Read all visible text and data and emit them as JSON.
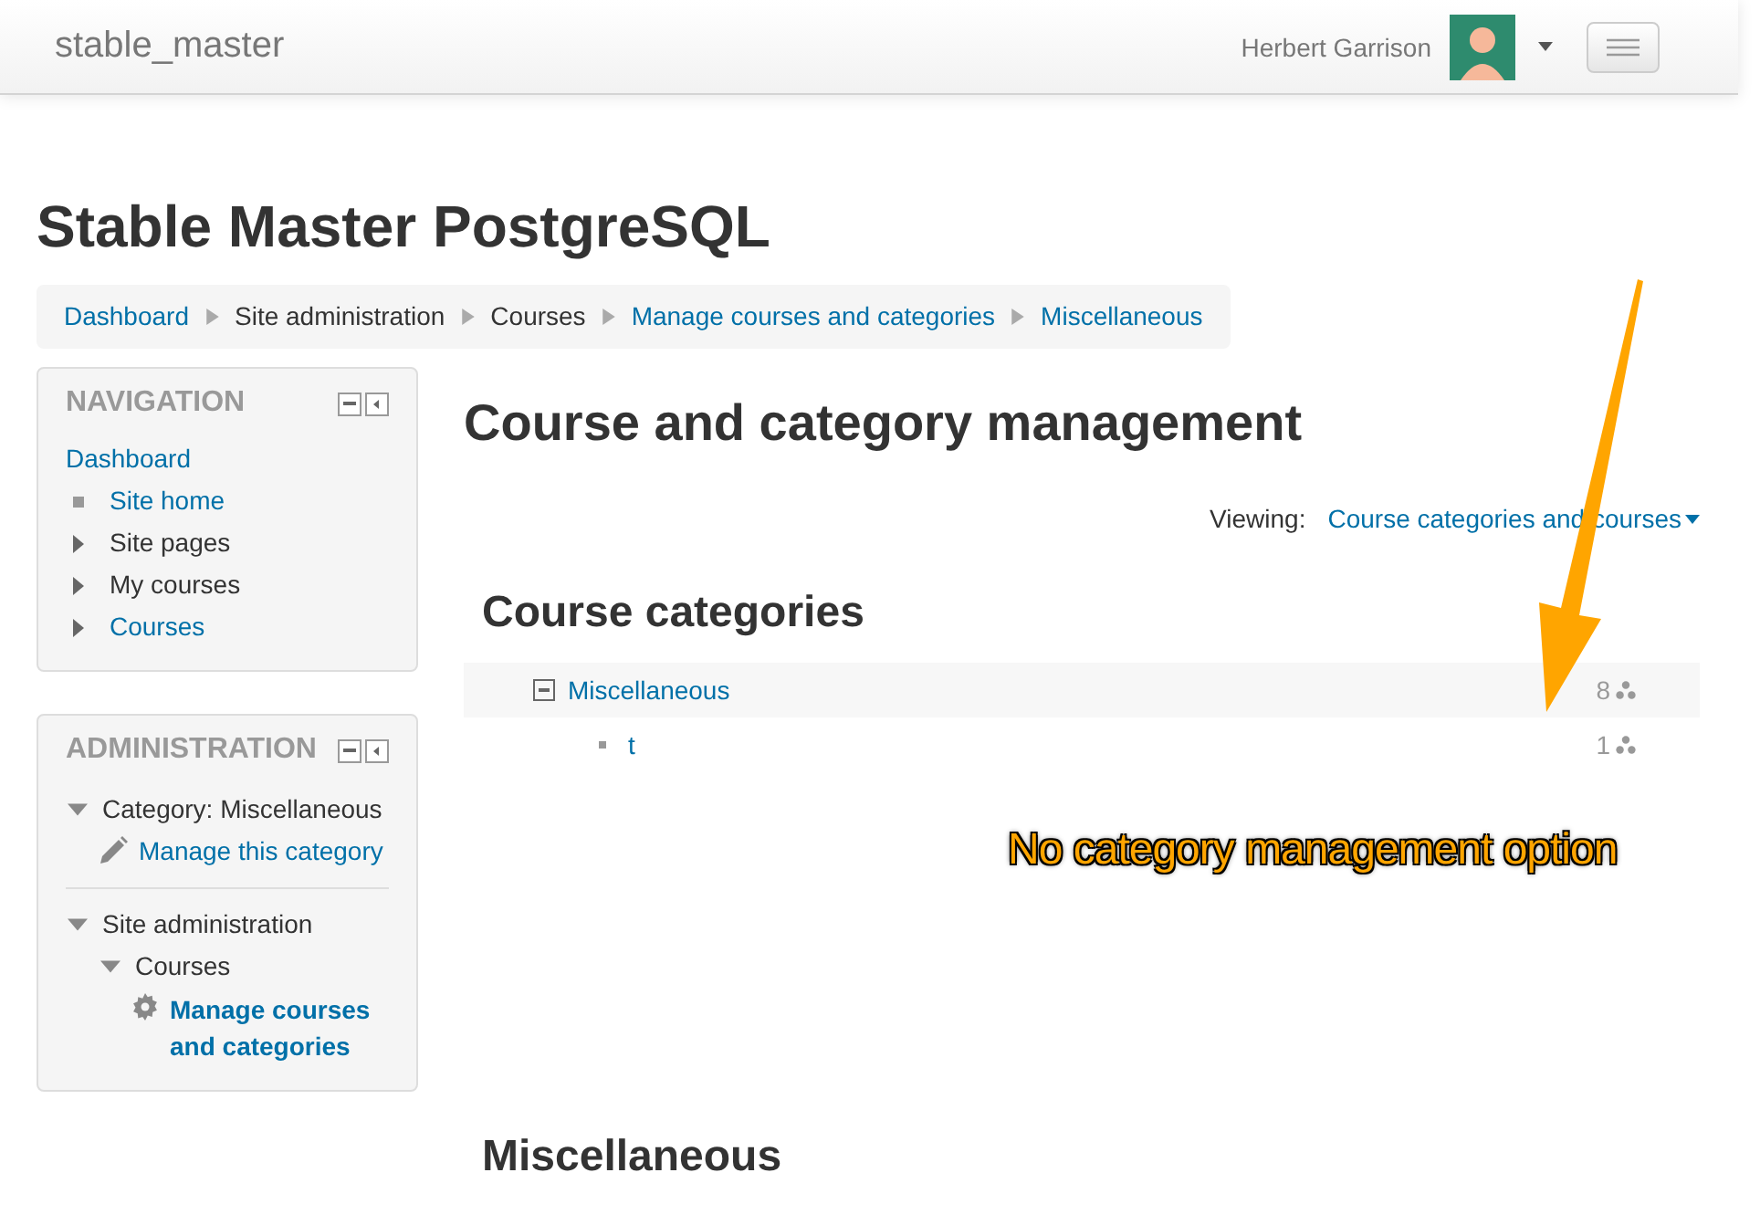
{
  "navbar": {
    "brand": "stable_master",
    "user_name": "Herbert Garrison"
  },
  "page_title": "Stable Master PostgreSQL",
  "breadcrumb": [
    {
      "label": "Dashboard",
      "link": true
    },
    {
      "label": "Site administration",
      "link": false
    },
    {
      "label": "Courses",
      "link": false
    },
    {
      "label": "Manage courses and categories",
      "link": true
    },
    {
      "label": "Miscellaneous",
      "link": true
    }
  ],
  "navigation_block": {
    "title": "NAVIGATION",
    "top_link": "Dashboard",
    "items": [
      {
        "label": "Site home",
        "kind": "bullet",
        "link": true
      },
      {
        "label": "Site pages",
        "kind": "collapsed",
        "link": false
      },
      {
        "label": "My courses",
        "kind": "collapsed",
        "link": false
      },
      {
        "label": "Courses",
        "kind": "collapsed",
        "link": true
      }
    ]
  },
  "administration_block": {
    "title": "ADMINISTRATION",
    "sections": [
      {
        "label": "Category: Miscellaneous",
        "expanded": true,
        "children": [
          {
            "label": "Manage this category",
            "kind": "edit",
            "current": false
          }
        ]
      },
      {
        "label": "Site administration",
        "expanded": true,
        "children": [
          {
            "label": "Courses",
            "kind": "branch",
            "expanded": true,
            "children": [
              {
                "label": "Manage courses and categories",
                "kind": "settings",
                "current": true
              }
            ]
          }
        ]
      }
    ]
  },
  "main": {
    "heading": "Course and category management",
    "viewing_label": "Viewing:",
    "viewing_value": "Course categories and courses",
    "categories_heading": "Course categories",
    "categories": [
      {
        "name": "Miscellaneous",
        "count": "8",
        "expanded": true,
        "children": [
          {
            "name": "t",
            "count": "1"
          }
        ]
      }
    ],
    "bottom_heading": "Miscellaneous"
  },
  "annotation": {
    "text": "No category management option"
  }
}
